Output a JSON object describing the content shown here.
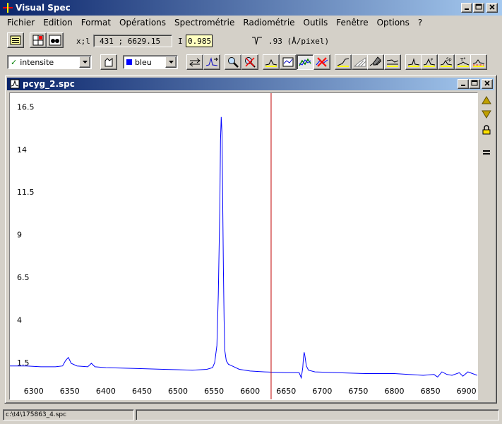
{
  "app": {
    "title": "Visual Spec"
  },
  "menu": [
    "Fichier",
    "Edition",
    "Format",
    "Opérations",
    "Spectrométrie",
    "Radiométrie",
    "Outils",
    "Fenêtre",
    "Options",
    "?"
  ],
  "toolbar1": {
    "coord_label": "x;l",
    "coord_value": "431 ; 6629.15",
    "intensity_label": "I",
    "intensity_value": "0.985",
    "dispersion_text": ".93 (Å/pixel)"
  },
  "toolbar2": {
    "profile_select": "intensite",
    "color_select": "bleu",
    "colors": {
      "color_swatch": "#0000ff"
    }
  },
  "document": {
    "title": "pcyg_2.spc"
  },
  "status": {
    "path": "c:\\t4\\175863_4.spc"
  },
  "chart_data": {
    "type": "line",
    "title": "",
    "xlabel": "",
    "ylabel": "",
    "xlim": [
      6267,
      6915
    ],
    "ylim": [
      0.5,
      17.3
    ],
    "x_ticks": [
      "6300",
      "6350",
      "6400",
      "6450",
      "6500",
      "6550",
      "6600",
      "6650",
      "6700",
      "6750",
      "6800",
      "6850",
      "6900"
    ],
    "y_ticks": [
      "1.5",
      "4",
      "6.5",
      "9",
      "11.5",
      "14",
      "16.5"
    ],
    "cursor_x": 6629.15,
    "series": [
      {
        "color": "#0000ff",
        "x": [
          6267,
          6290,
          6310,
          6330,
          6340,
          6344,
          6348,
          6352,
          6360,
          6375,
          6380,
          6385,
          6400,
          6440,
          6480,
          6520,
          6540,
          6548,
          6551,
          6554,
          6556,
          6558,
          6559,
          6560,
          6561,
          6562,
          6563,
          6564,
          6565,
          6567,
          6570,
          6575,
          6585,
          6600,
          6620,
          6650,
          6668,
          6671,
          6673,
          6674,
          6675,
          6676,
          6678,
          6681,
          6690,
          6720,
          6760,
          6800,
          6840,
          6855,
          6860,
          6866,
          6873,
          6880,
          6890,
          6895,
          6902,
          6915
        ],
        "y": [
          1.3,
          1.3,
          1.25,
          1.25,
          1.3,
          1.6,
          1.8,
          1.45,
          1.3,
          1.25,
          1.45,
          1.25,
          1.2,
          1.15,
          1.1,
          1.05,
          1.1,
          1.2,
          1.5,
          2.5,
          5.5,
          10.5,
          14.5,
          15.9,
          15.0,
          11.0,
          7.0,
          4.0,
          2.2,
          1.6,
          1.4,
          1.3,
          1.1,
          1.0,
          0.95,
          0.9,
          0.9,
          0.6,
          1.2,
          1.8,
          2.1,
          1.9,
          1.3,
          1.05,
          0.95,
          0.9,
          0.85,
          0.85,
          0.75,
          0.8,
          0.65,
          0.95,
          0.8,
          0.75,
          0.9,
          0.7,
          0.95,
          0.75
        ]
      }
    ]
  }
}
